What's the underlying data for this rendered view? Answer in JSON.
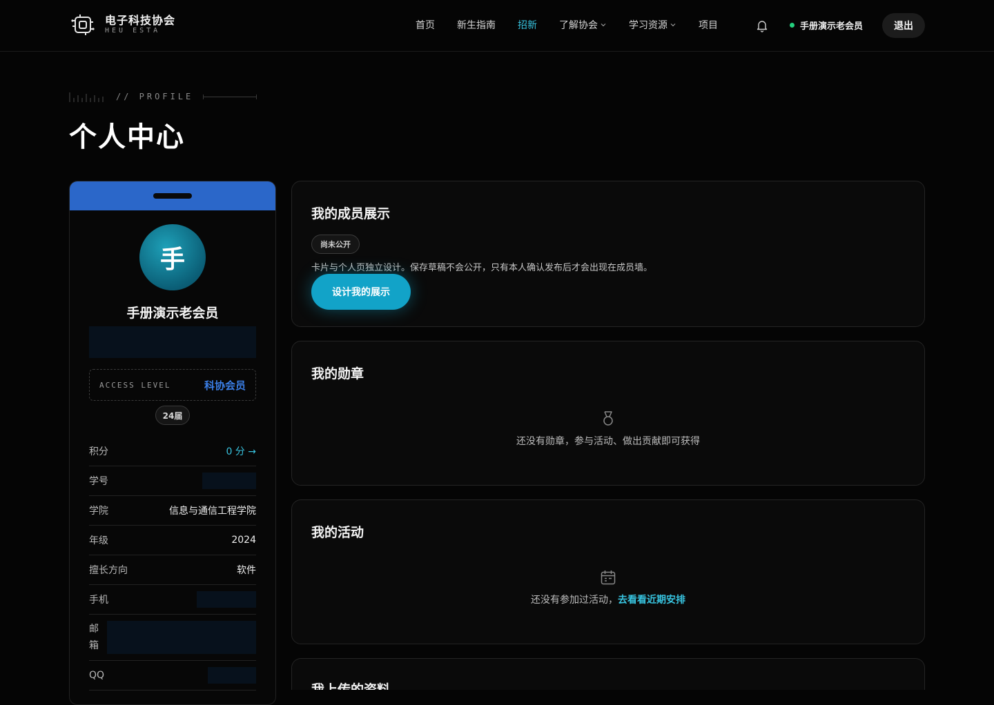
{
  "brand": {
    "name_cn": "电子科技协会",
    "name_en": "HEU ESTA"
  },
  "nav": {
    "items": [
      {
        "label": "首页",
        "active": false,
        "dropdown": false
      },
      {
        "label": "新生指南",
        "active": false,
        "dropdown": false
      },
      {
        "label": "招新",
        "active": true,
        "dropdown": false
      },
      {
        "label": "了解协会",
        "active": false,
        "dropdown": true
      },
      {
        "label": "学习资源",
        "active": false,
        "dropdown": true
      },
      {
        "label": "项目",
        "active": false,
        "dropdown": false
      }
    ],
    "notification_icon": "bell-icon",
    "user_name": "手册演示老会员",
    "user_status_color": "#23d07e",
    "logout_label": "退出"
  },
  "page": {
    "eyebrow": "// PROFILE",
    "title": "个人中心"
  },
  "profile": {
    "header_color": "#2b67c9",
    "avatar_char": "手",
    "name": "手册演示老会员",
    "access_label": "ACCESS LEVEL",
    "access_value": "科协会员",
    "term": "24届",
    "fields": {
      "points": {
        "label": "积分",
        "value": "0 分 →"
      },
      "student_id": {
        "label": "学号"
      },
      "college": {
        "label": "学院",
        "value": "信息与通信工程学院"
      },
      "grade": {
        "label": "年级",
        "value": "2024"
      },
      "specialty": {
        "label": "擅长方向",
        "value": "软件"
      },
      "phone": {
        "label": "手机"
      },
      "email": {
        "label_1": "邮",
        "label_2": "箱"
      },
      "qq": {
        "label": "QQ"
      }
    }
  },
  "cards": {
    "showcase": {
      "title": "我的成员展示",
      "status": "尚未公开",
      "description": "卡片与个人页独立设计。保存草稿不会公开，只有本人确认发布后才会出现在成员墙。",
      "button": "设计我的展示"
    },
    "badges": {
      "title": "我的勋章",
      "icon": "medal-icon",
      "empty": "还没有勋章，参与活动、做出贡献即可获得"
    },
    "activities": {
      "title": "我的活动",
      "icon": "calendar-icon",
      "empty": "还没有参加过活动，",
      "link": "去看看近期安排"
    },
    "uploads": {
      "title": "我上传的资料"
    }
  },
  "colors": {
    "accent": "#38c4e0",
    "primary_button": "#12a3c8",
    "access": "#3a7ee6"
  }
}
